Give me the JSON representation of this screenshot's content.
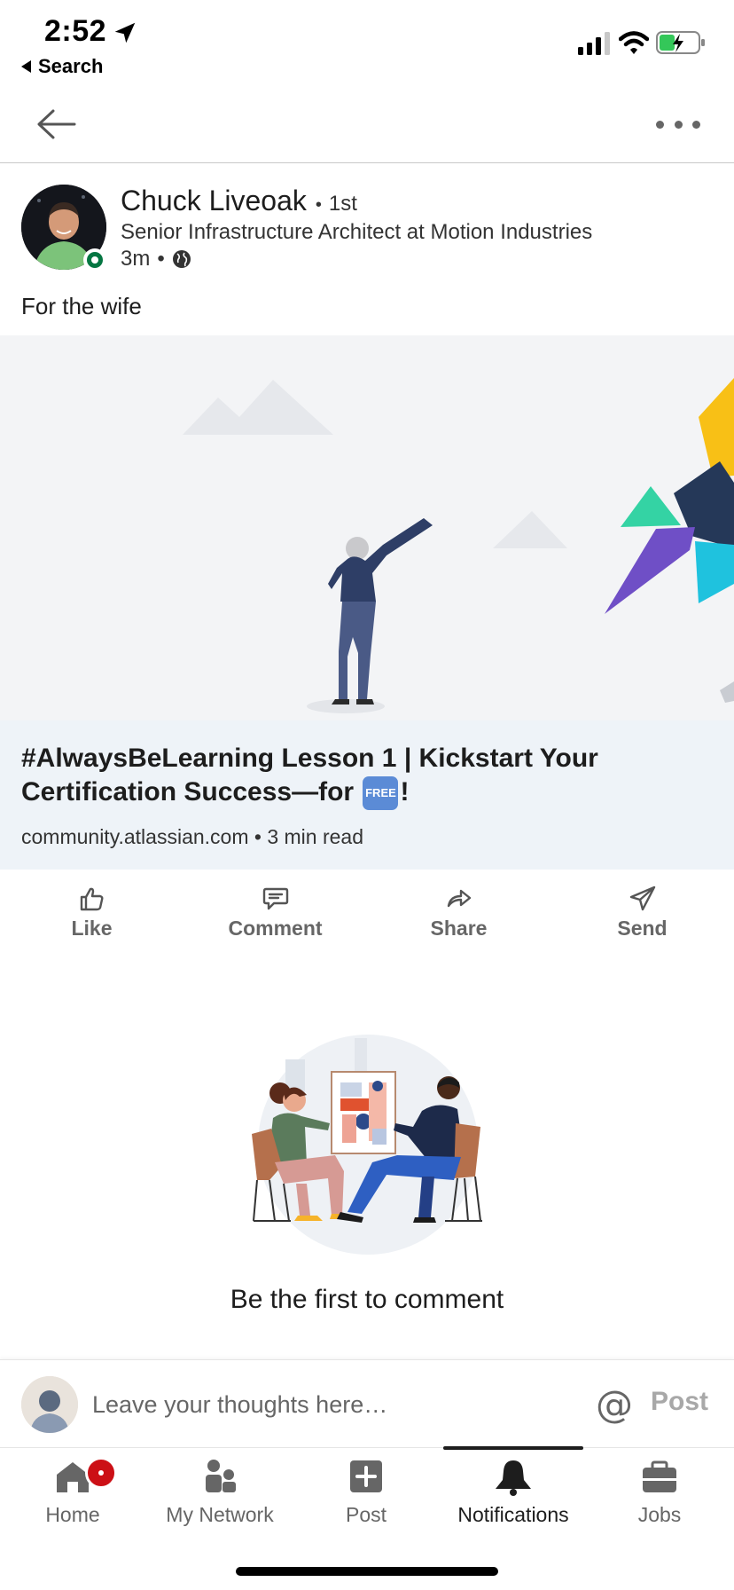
{
  "status_bar": {
    "time": "2:52",
    "back_app": "Search"
  },
  "post": {
    "author": {
      "name": "Chuck Liveoak",
      "degree": "1st",
      "headline": "Senior Infrastructure Architect at Motion Industries",
      "time": "3m",
      "visibility_icon": "globe-icon",
      "online": true
    },
    "text": "For the wife",
    "article": {
      "title_before": "#AlwaysBeLearning Lesson 1 | Kickstart Your Certification Success—for",
      "badge": "FREE",
      "title_after": "!",
      "source": "community.atlassian.com",
      "read_time": "3 min read"
    }
  },
  "actions": [
    {
      "label": "Like",
      "icon": "thumbs-up-icon"
    },
    {
      "label": "Comment",
      "icon": "comment-icon"
    },
    {
      "label": "Share",
      "icon": "share-arrow-icon"
    },
    {
      "label": "Send",
      "icon": "send-icon"
    }
  ],
  "comments": {
    "empty_text": "Be the first to comment"
  },
  "comment_bar": {
    "placeholder": "Leave your thoughts here…",
    "mention_symbol": "@",
    "post_label": "Post"
  },
  "tabs": [
    {
      "label": "Home",
      "icon": "home-icon",
      "badge": true
    },
    {
      "label": "My Network",
      "icon": "network-icon"
    },
    {
      "label": "Post",
      "icon": "plus-square-icon"
    },
    {
      "label": "Notifications",
      "icon": "bell-icon",
      "active": true
    },
    {
      "label": "Jobs",
      "icon": "briefcase-icon"
    }
  ],
  "colors": {
    "online_green": "#057642",
    "badge_red": "#cc1016",
    "caption_bg": "#eef3f8",
    "muted_text": "#666666"
  }
}
